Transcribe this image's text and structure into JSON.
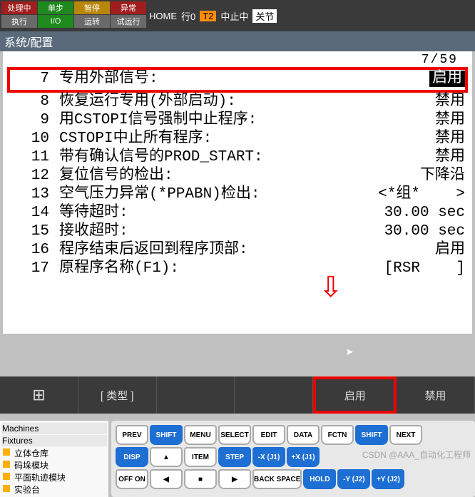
{
  "topButtons": [
    {
      "t": "处理中",
      "c": "r"
    },
    {
      "t": "单步",
      "c": "g"
    },
    {
      "t": "智停",
      "c": "og"
    },
    {
      "t": "异常",
      "c": "r"
    },
    {
      "t": "执行",
      "c": "gr"
    },
    {
      "t": "I/O",
      "c": "g"
    },
    {
      "t": "运转",
      "c": "gr"
    },
    {
      "t": "试运行",
      "c": "gr"
    }
  ],
  "status": {
    "home": "HOME",
    "line": "行0",
    "speed": "T2",
    "halt": "中止中",
    "joint": "关节"
  },
  "title": "系统/配置",
  "scroll": "7/59",
  "rows": [
    {
      "n": "7",
      "l": "专用外部信号:",
      "v": "启用",
      "sel": true
    },
    {
      "n": "8",
      "l": "恢复运行专用(外部启动):",
      "v": "禁用"
    },
    {
      "n": "9",
      "l": "用CSTOPI信号强制中止程序:",
      "v": "禁用"
    },
    {
      "n": "10",
      "l": "CSTOPI中止所有程序:",
      "v": "禁用"
    },
    {
      "n": "11",
      "l": "带有确认信号的PROD_START:",
      "v": "禁用"
    },
    {
      "n": "12",
      "l": "复位信号的检出:",
      "v": "下降沿"
    },
    {
      "n": "13",
      "l": "空气压力异常(*PPABN)检出:",
      "v": "<*组*    >"
    },
    {
      "n": "14",
      "l": "等待超时:",
      "v": "30.00 sec"
    },
    {
      "n": "15",
      "l": "接收超时:",
      "v": "30.00 sec"
    },
    {
      "n": "16",
      "l": "程序结束后返回到程序顶部:",
      "v": "启用"
    },
    {
      "n": "17",
      "l": "原程序名称(F1):",
      "v": "[RSR    ]"
    }
  ],
  "fkeys": {
    "grid": "⊞",
    "type": "[ 类型 ]",
    "enable": "启用",
    "disable": "禁用"
  },
  "tree": {
    "h1": "Machines",
    "h2": "Fixtures",
    "items": [
      "立体仓库",
      "码垛模块",
      "平面轨迹模块",
      "实验台"
    ]
  },
  "kbd": {
    "r1": [
      "PREV",
      "SHIFT",
      "MENU",
      "SELECT",
      "EDIT",
      "DATA",
      "FCTN",
      "SHIFT",
      "NEXT"
    ],
    "r2": [
      "DISP",
      "▲",
      "ITEM",
      "STEP",
      "-X (J1)",
      "+X (J1)"
    ],
    "r3": [
      "OFF ON",
      "◀",
      "■",
      "▶",
      "BACK SPACE",
      "HOLD",
      "-Y (J2)",
      "+Y (J2)"
    ]
  },
  "watermark": "CSDN @AAA_自动化工程师"
}
